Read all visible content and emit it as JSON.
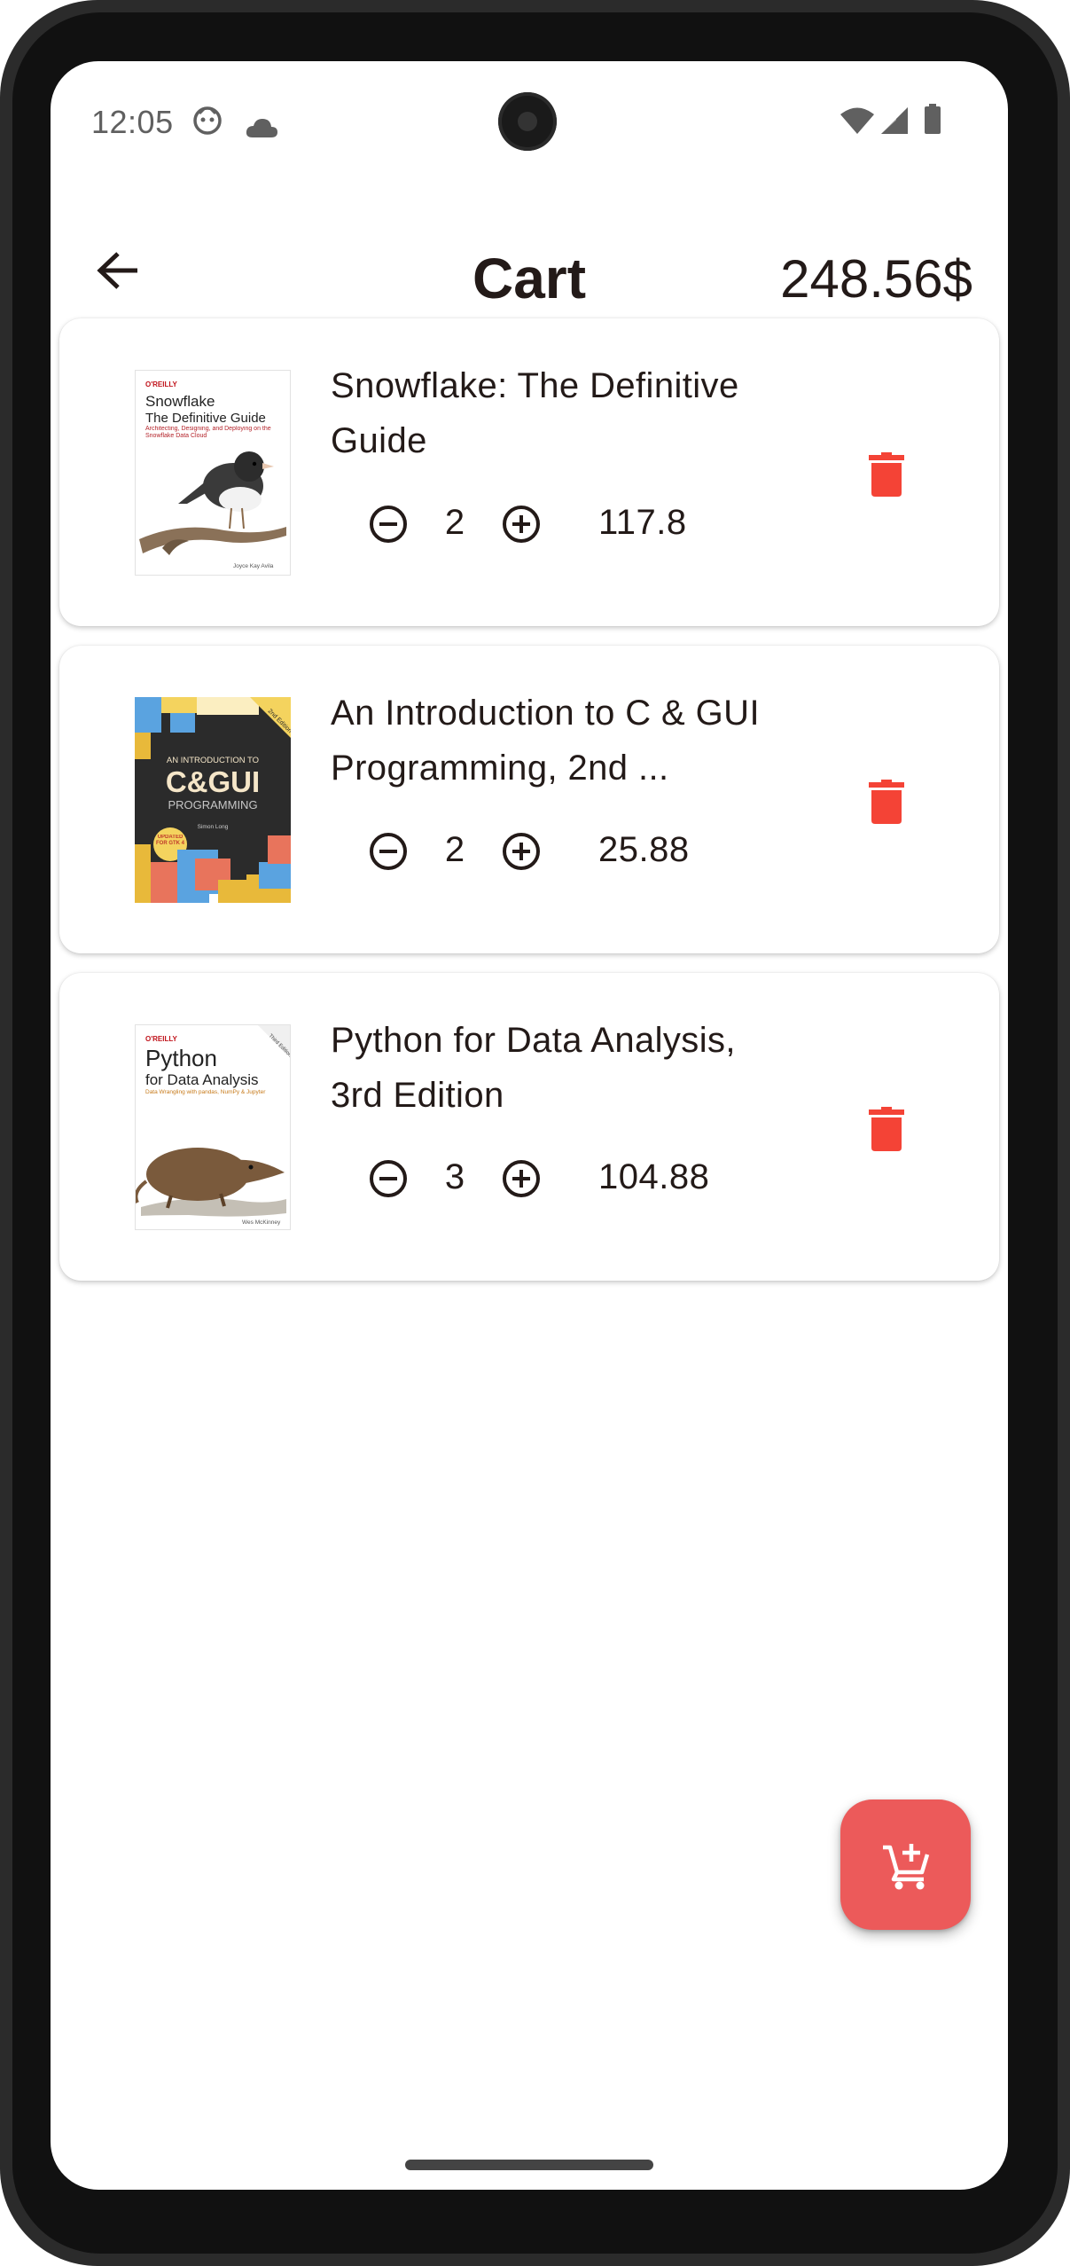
{
  "status_bar": {
    "time": "12:05",
    "left_icons": [
      "face-icon",
      "cloud-icon"
    ],
    "right_icons": [
      "wifi-icon",
      "signal-icon",
      "battery-icon"
    ]
  },
  "app_bar": {
    "back_icon": "arrow-back-icon",
    "title": "Cart",
    "total": "248.56$"
  },
  "cart_items": [
    {
      "title": "Snowflake: The Definitive Guide",
      "quantity": "2",
      "price": "117.8",
      "cover": {
        "publisher": "O'REILLY",
        "book_title_line1": "Snowflake",
        "book_title_line2": "The Definitive Guide",
        "subtitle": "Architecting, Designing, and Deploying on the Snowflake Data Cloud",
        "author": "Joyce Kay Avila"
      }
    },
    {
      "title": "An Introduction to C & GUI Programming, 2nd ...",
      "quantity": "2",
      "price": "25.88",
      "cover": {
        "top_line": "AN INTRODUCTION TO",
        "big_line": "C&GUI",
        "bottom_line": "PROGRAMMING",
        "badge": "UPDATED FOR GTK 4",
        "author": "Simon Long",
        "edition": "2nd Edition"
      }
    },
    {
      "title": "Python for Data Analysis, 3rd Edition",
      "quantity": "3",
      "price": "104.88",
      "cover": {
        "publisher": "O'REILLY",
        "book_title_line1": "Python",
        "book_title_line2": "for Data Analysis",
        "subtitle": "Data Wrangling with pandas, NumPy & Jupyter",
        "author": "Wes McKinney",
        "corner": "Third Edition"
      }
    }
  ],
  "icons": {
    "decrement": "minus-circle-icon",
    "increment": "plus-circle-icon",
    "delete": "trash-icon",
    "fab": "add-shopping-cart-icon"
  },
  "colors": {
    "accent": "#ec5a5a",
    "delete_red": "#f44336",
    "text": "#231a18"
  }
}
